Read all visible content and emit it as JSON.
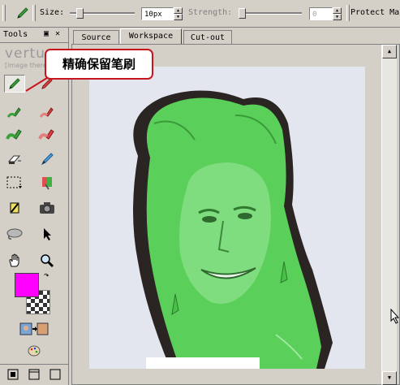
{
  "options_bar": {
    "size_label": "Size:",
    "size_value": "10px",
    "size_slider_fraction": 0.1,
    "strength_label": "Strength:",
    "strength_value": "0",
    "strength_slider_fraction": 0.0,
    "protect_label": "Protect Ma"
  },
  "tools_panel": {
    "title": "Tools",
    "logo_text": "vertu",
    "logo_sub": "[image there",
    "tools": [
      "precise-keep-brush-icon",
      "precise-remove-brush-icon",
      "keep-brush-icon",
      "remove-brush-icon",
      "keep-highlighter-icon",
      "remove-highlighter-icon",
      "eraser-icon",
      "pen-icon",
      "selection-icon",
      "color-picker-icon",
      "magic-wand-icon",
      "camera-icon",
      "lasso-icon",
      "arrow-pointer-icon",
      "hand-icon",
      "zoom-icon"
    ],
    "foreground_color": "#ff00ff",
    "background_pattern": "checkerboard"
  },
  "tabs": [
    {
      "label": "Source",
      "selected": false
    },
    {
      "label": "Workspace",
      "selected": true
    },
    {
      "label": "Cut-out",
      "selected": false
    }
  ],
  "callout": {
    "text": "精确保留笔刷",
    "border_color": "#c8141e"
  },
  "colors": {
    "keep_overlay": "#5ad05a",
    "chrome": "#d4d0c8"
  }
}
